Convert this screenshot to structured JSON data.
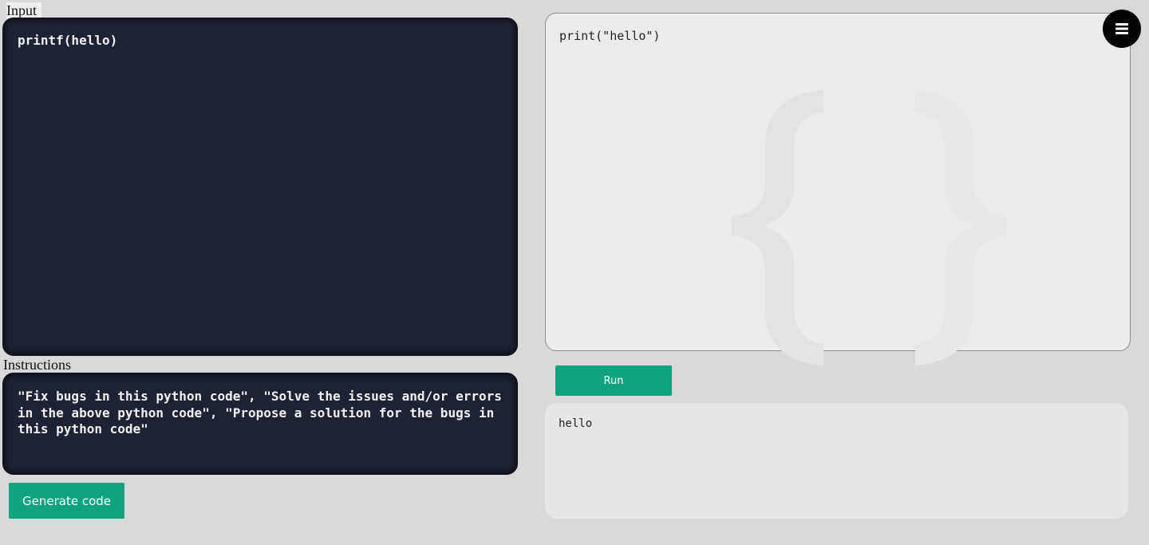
{
  "labels": {
    "input": "Input",
    "instructions": "Instructions"
  },
  "editors": {
    "input_code": "printf(hello)",
    "instructions_text": "\"Fix bugs in this python code\", \"Solve the issues and/or errors in the above python code\", \"Propose a solution for the bugs in this python code\""
  },
  "buttons": {
    "generate": "Generate code",
    "run": "Run"
  },
  "output": {
    "code": "print(\"hello\")",
    "console": "hello"
  },
  "icons": {
    "menu": "hamburger-menu-icon",
    "watermark": "curly-braces-icon"
  },
  "colors": {
    "background": "#d9d9d9",
    "editor_bg": "#1e2334",
    "accent": "#10a37f",
    "output_bg": "#ececec",
    "console_bg": "#e6e6e6"
  }
}
